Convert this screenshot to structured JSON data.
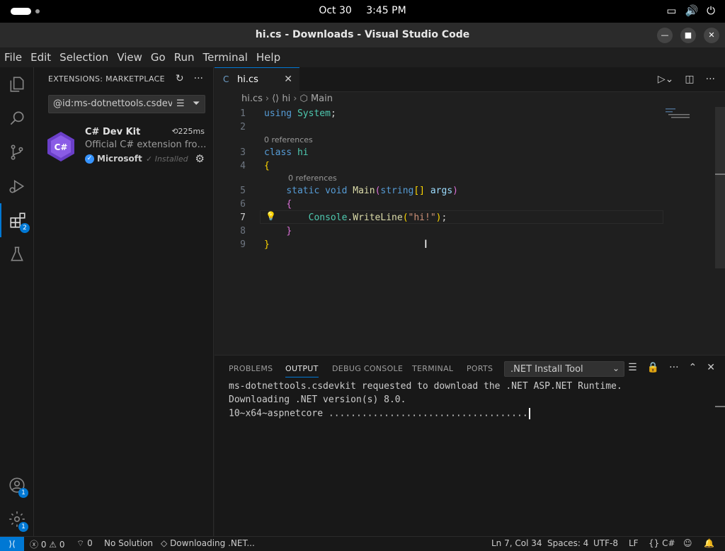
{
  "os": {
    "date": "Oct 30",
    "time": "3:45 PM"
  },
  "window": {
    "title": "hi.cs - Downloads - Visual Studio Code"
  },
  "menu": [
    "File",
    "Edit",
    "Selection",
    "View",
    "Go",
    "Run",
    "Terminal",
    "Help"
  ],
  "activity": {
    "extensions_badge": "2",
    "accounts_badge": "1",
    "manage_badge": "1"
  },
  "sidebar": {
    "title": "EXTENSIONS: MARKETPLACE",
    "search_value": "@id:ms-dotnettools.csdevkit",
    "extension": {
      "logo_text": "C#",
      "name": "C# Dev Kit",
      "time": "225ms",
      "description": "Official C# extension from Microsoft",
      "publisher": "Microsoft",
      "status": "Installed"
    }
  },
  "editor": {
    "tab_label": "hi.cs",
    "tab_icon": "C",
    "breadcrumb": {
      "file": "hi.cs",
      "class": "hi",
      "method": "Main"
    },
    "lens1": "0 references",
    "lens2": "0 references",
    "line_numbers": [
      "1",
      "2",
      "3",
      "4",
      "5",
      "6",
      "7",
      "8",
      "9"
    ],
    "code": {
      "l1_kw": "using",
      "l1_ns": "System",
      "l3_kw": "class",
      "l3_name": "hi",
      "l5_kw1": "static",
      "l5_kw2": "void",
      "l5_fn": "Main",
      "l5_ty": "string",
      "l5_arr": "[]",
      "l5_param": "args",
      "l7_cls": "Console",
      "l7_fn": "WriteLine",
      "l7_str": "\"hi!\""
    }
  },
  "panel": {
    "tabs": [
      "PROBLEMS",
      "OUTPUT",
      "DEBUG CONSOLE",
      "TERMINAL",
      "PORTS"
    ],
    "selector": ".NET Install Tool",
    "output_lines": [
      "ms-dotnettools.csdevkit requested to download the .NET ASP.NET Runtime.",
      "Downloading .NET version(s) 8.0.",
      "10~x64~aspnetcore ...................................."
    ]
  },
  "status": {
    "errors": "0",
    "warnings": "0",
    "ports": "0",
    "solution": "No Solution",
    "task": "Downloading .NET...",
    "position": "Ln 7, Col 34",
    "spaces": "Spaces: 4",
    "encoding": "UTF-8",
    "eol": "LF",
    "language": "C#"
  },
  "colors": {
    "accent": "#0078d4",
    "keyword": "#569cd6",
    "type": "#4ec9b0",
    "function": "#dcdcaa",
    "string": "#ce9178"
  }
}
